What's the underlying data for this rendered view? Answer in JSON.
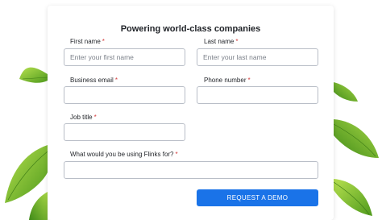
{
  "form": {
    "title": "Powering world-class companies",
    "required_marker": "*",
    "fields": {
      "first_name": {
        "label": "First name",
        "placeholder": "Enter your first name",
        "value": ""
      },
      "last_name": {
        "label": "Last name",
        "placeholder": "Enter your last name",
        "value": ""
      },
      "business_email": {
        "label": "Business email",
        "placeholder": "",
        "value": ""
      },
      "phone_number": {
        "label": "Phone number",
        "placeholder": "",
        "value": ""
      },
      "job_title": {
        "label": "Job title",
        "placeholder": "",
        "value": ""
      },
      "use_case": {
        "label": "What would you be using Flinks for?",
        "placeholder": "",
        "value": ""
      }
    },
    "submit_label": "REQUEST A DEMO"
  },
  "colors": {
    "accent": "#1a73e8",
    "required": "#d33b3b",
    "leaf": "#7ec12d",
    "leaf_dark": "#4f9a1c"
  },
  "decorations": [
    "leaf-icon"
  ]
}
